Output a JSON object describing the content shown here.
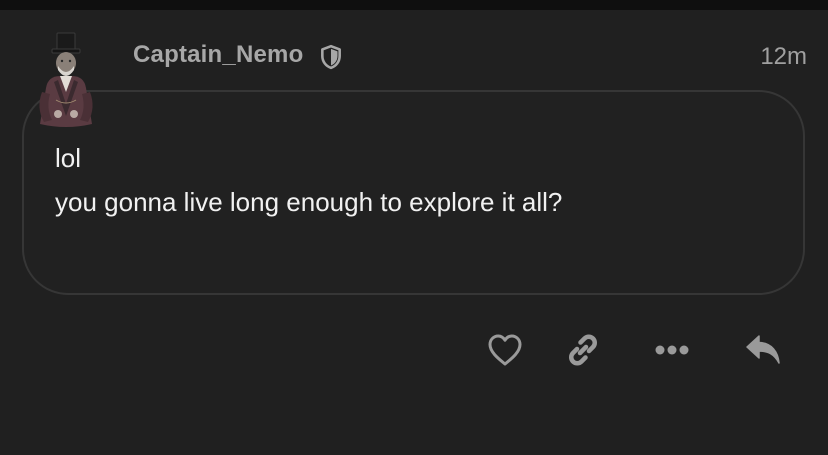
{
  "post": {
    "author": "Captain_Nemo",
    "author_badge_icon": "shield-icon",
    "time_ago": "12m",
    "avatar_icon": "top-hat-gentleman-avatar",
    "message_lines": [
      "lol",
      "you gonna live long enough to explore it all?"
    ]
  },
  "actions": [
    {
      "name": "like",
      "icon": "heart-icon"
    },
    {
      "name": "copy-link",
      "icon": "link-icon"
    },
    {
      "name": "more-options",
      "icon": "ellipsis-icon"
    },
    {
      "name": "reply",
      "icon": "reply-arrow-icon"
    }
  ],
  "colors": {
    "background": "#202020",
    "top_strip": "#0f0f0f",
    "username": "#a7a7a7",
    "timestamp": "#a0a0a0",
    "message_text": "#f1f1f1",
    "bubble_border": "#363636",
    "icon": "#9a9a9a"
  }
}
